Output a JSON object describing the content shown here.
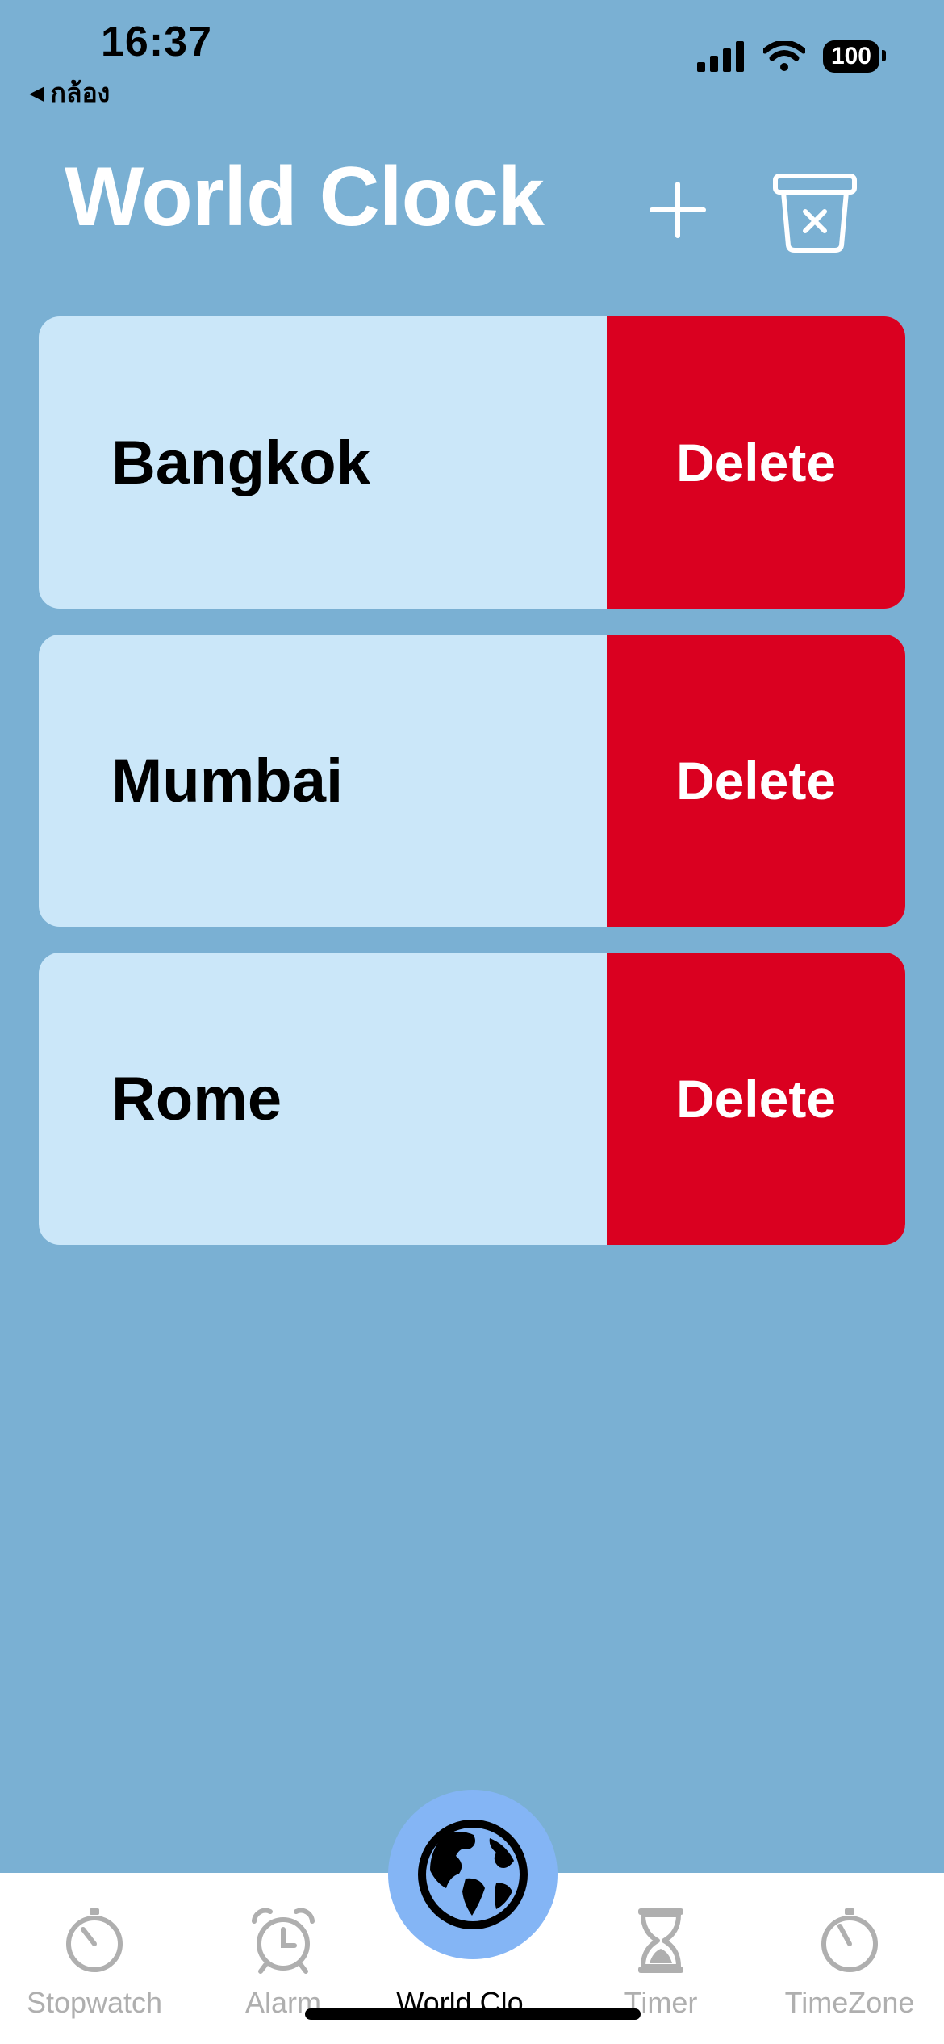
{
  "status_bar": {
    "time": "16:37",
    "back_label": "กล้อง",
    "battery": "100"
  },
  "header": {
    "title": "World Clock"
  },
  "cities": [
    {
      "name": "Bangkok",
      "delete_label": "Delete"
    },
    {
      "name": "Mumbai",
      "delete_label": "Delete"
    },
    {
      "name": "Rome",
      "delete_label": "Delete"
    }
  ],
  "tabs": [
    {
      "label": "Stopwatch",
      "icon": "stopwatch-icon",
      "active": false
    },
    {
      "label": "Alarm",
      "icon": "alarm-icon",
      "active": false
    },
    {
      "label": "World Clo...",
      "icon": "globe-icon",
      "active": true
    },
    {
      "label": "Timer",
      "icon": "hourglass-icon",
      "active": false
    },
    {
      "label": "TimeZone",
      "icon": "gauge-icon",
      "active": false
    }
  ],
  "colors": {
    "background": "#7AB0D3",
    "row": "#CBE7F9",
    "delete": "#DA0020",
    "active_tab_circle": "#84B5F5",
    "inactive_tab": "#AFAFAF"
  }
}
